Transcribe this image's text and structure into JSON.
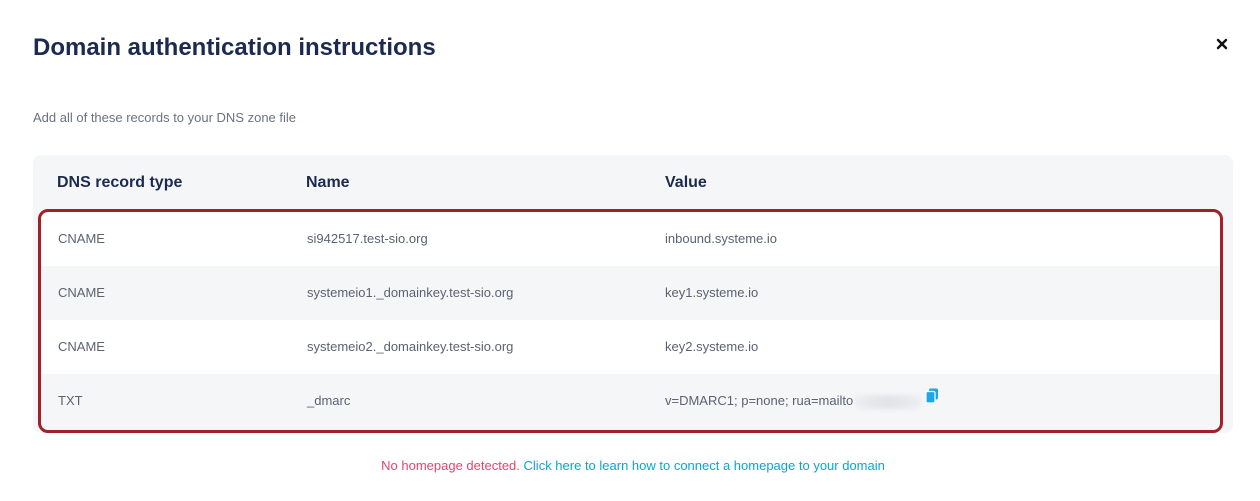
{
  "modal": {
    "title": "Domain authentication instructions",
    "subtitle": "Add all of these records to your DNS zone file"
  },
  "table": {
    "headers": [
      "DNS record type",
      "Name",
      "Value"
    ],
    "rows": [
      {
        "type": "CNAME",
        "name": "si942517.test-sio.org",
        "value": "inbound.systeme.io"
      },
      {
        "type": "CNAME",
        "name": "systemeio1._domainkey.test-sio.org",
        "value": "key1.systeme.io"
      },
      {
        "type": "CNAME",
        "name": "systemeio2._domainkey.test-sio.org",
        "value": "key2.systeme.io"
      },
      {
        "type": "TXT",
        "name": "_dmarc",
        "value": "v=DMARC1; p=none; rua=mailto"
      }
    ]
  },
  "footer": {
    "warning": "No homepage detected.",
    "link": "Click here to learn how to connect a homepage to your domain"
  },
  "colors": {
    "title": "#1b2a4e",
    "highlight_border": "#a3202b",
    "warning": "#e5466b",
    "link": "#0aa5d3",
    "copy_icon": "#1ea7e4"
  },
  "icons": {
    "close": "close-icon",
    "copy": "copy-icon"
  }
}
